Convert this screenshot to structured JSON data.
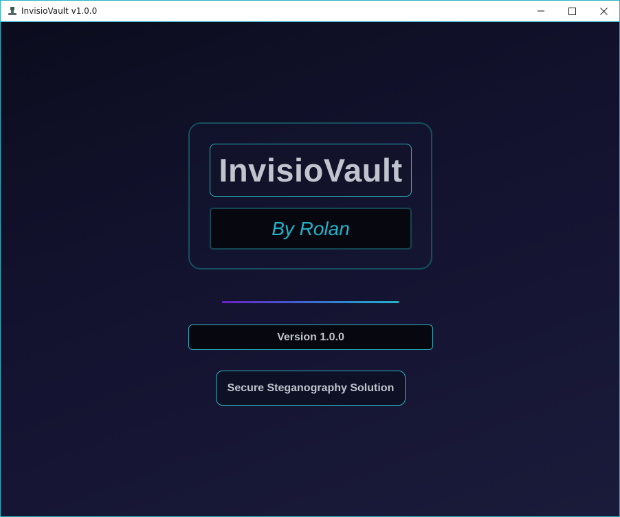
{
  "window": {
    "title": "InvisioVault v1.0.0",
    "app_icon": "app-icon"
  },
  "titlebar_buttons": {
    "minimize_icon": "minimize-icon",
    "maximize_icon": "maximize-icon",
    "close_icon": "close-icon"
  },
  "splash": {
    "app_name": "InvisioVault",
    "author": "By Rolan",
    "version": "Version 1.0.0",
    "tagline": "Secure Steganography Solution"
  },
  "colors": {
    "accent": "#2bb3c4",
    "author_text": "#20b2c8",
    "divider_start": "#6a1fc8",
    "divider_end": "#1fb5c8",
    "background": "#131330",
    "text": "#c0c4cc"
  }
}
